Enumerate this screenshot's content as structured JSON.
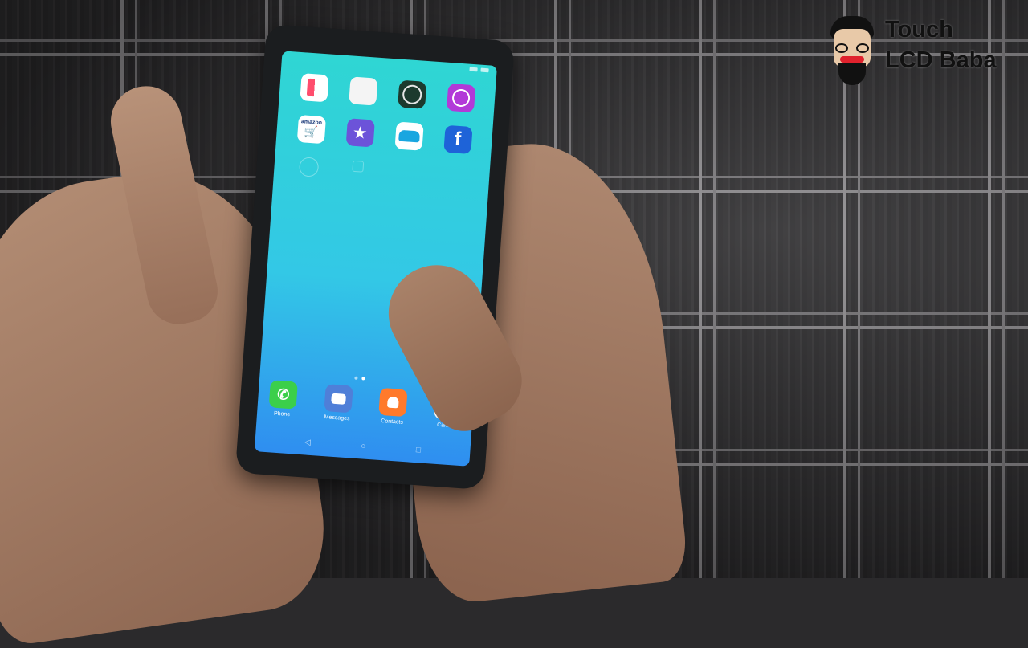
{
  "logo": {
    "line1": "Touch",
    "line2": "LCD Baba"
  },
  "home_screen": {
    "apps": [
      {
        "icon": "calendar-icon"
      },
      {
        "icon": "notes-icon"
      },
      {
        "icon": "clock-icon"
      },
      {
        "icon": "download-icon"
      },
      {
        "icon": "amazon-shopping-icon",
        "brand": "amazon"
      },
      {
        "icon": "star-icon"
      },
      {
        "icon": "car-game-icon"
      },
      {
        "icon": "facebook-icon",
        "glyph": "f"
      },
      {
        "icon": "ghost-app-icon"
      },
      {
        "icon": "ghost-app-icon-2"
      }
    ],
    "page_indicator": {
      "pages": 2,
      "active": 2
    },
    "dock": [
      {
        "label": "Phone",
        "icon": "phone-icon"
      },
      {
        "label": "Messages",
        "icon": "messages-icon"
      },
      {
        "label": "Contacts",
        "icon": "contacts-icon"
      },
      {
        "label": "Camera",
        "icon": "camera-icon"
      }
    ],
    "navbar": {
      "back": "◁",
      "home": "○",
      "recent": "□"
    }
  },
  "colors": {
    "screen_top": "#2fd6d3",
    "screen_bottom": "#2f8ef0",
    "logo_text": "#111111",
    "logo_mustache": "#e0222d"
  }
}
